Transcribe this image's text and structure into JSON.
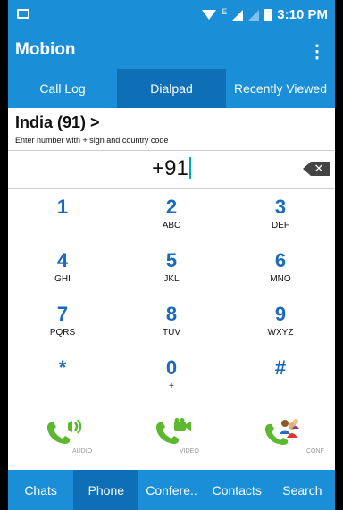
{
  "status_bar": {
    "time": "3:10 PM",
    "network_label": "E"
  },
  "app": {
    "title": "Mobion",
    "menu_icon": "more-vert-icon"
  },
  "tabs": [
    {
      "label": "Call Log",
      "active": false
    },
    {
      "label": "Dialpad",
      "active": true
    },
    {
      "label": "Recently Viewed",
      "active": false
    }
  ],
  "country": {
    "name": "India (91) >",
    "hint": "Enter number with + sign and country code"
  },
  "number": {
    "value": "+91"
  },
  "keypad": {
    "keys": [
      {
        "digit": "1",
        "letters": ""
      },
      {
        "digit": "2",
        "letters": "ABC"
      },
      {
        "digit": "3",
        "letters": "DEF"
      },
      {
        "digit": "4",
        "letters": "GHI"
      },
      {
        "digit": "5",
        "letters": "JKL"
      },
      {
        "digit": "6",
        "letters": "MNO"
      },
      {
        "digit": "7",
        "letters": "PQRS"
      },
      {
        "digit": "8",
        "letters": "TUV"
      },
      {
        "digit": "9",
        "letters": "WXYZ"
      },
      {
        "digit": "*",
        "letters": ""
      },
      {
        "digit": "0",
        "letters": "+"
      },
      {
        "digit": "#",
        "letters": ""
      }
    ]
  },
  "call_buttons": [
    {
      "label": "AUDIO",
      "icon": "audio-call-icon"
    },
    {
      "label": "VIDEO",
      "icon": "video-call-icon"
    },
    {
      "label": "CONF",
      "icon": "conference-call-icon"
    }
  ],
  "bottom_nav": [
    {
      "label": "Chats",
      "active": false
    },
    {
      "label": "Phone",
      "active": true
    },
    {
      "label": "Confere..",
      "active": false
    },
    {
      "label": "Contacts",
      "active": false
    },
    {
      "label": "Search",
      "active": false
    }
  ],
  "colors": {
    "primary": "#1a8fd8",
    "primary_dark": "#0e6fb7",
    "digit": "#1a6bbd",
    "call_green": "#5cb82e"
  }
}
